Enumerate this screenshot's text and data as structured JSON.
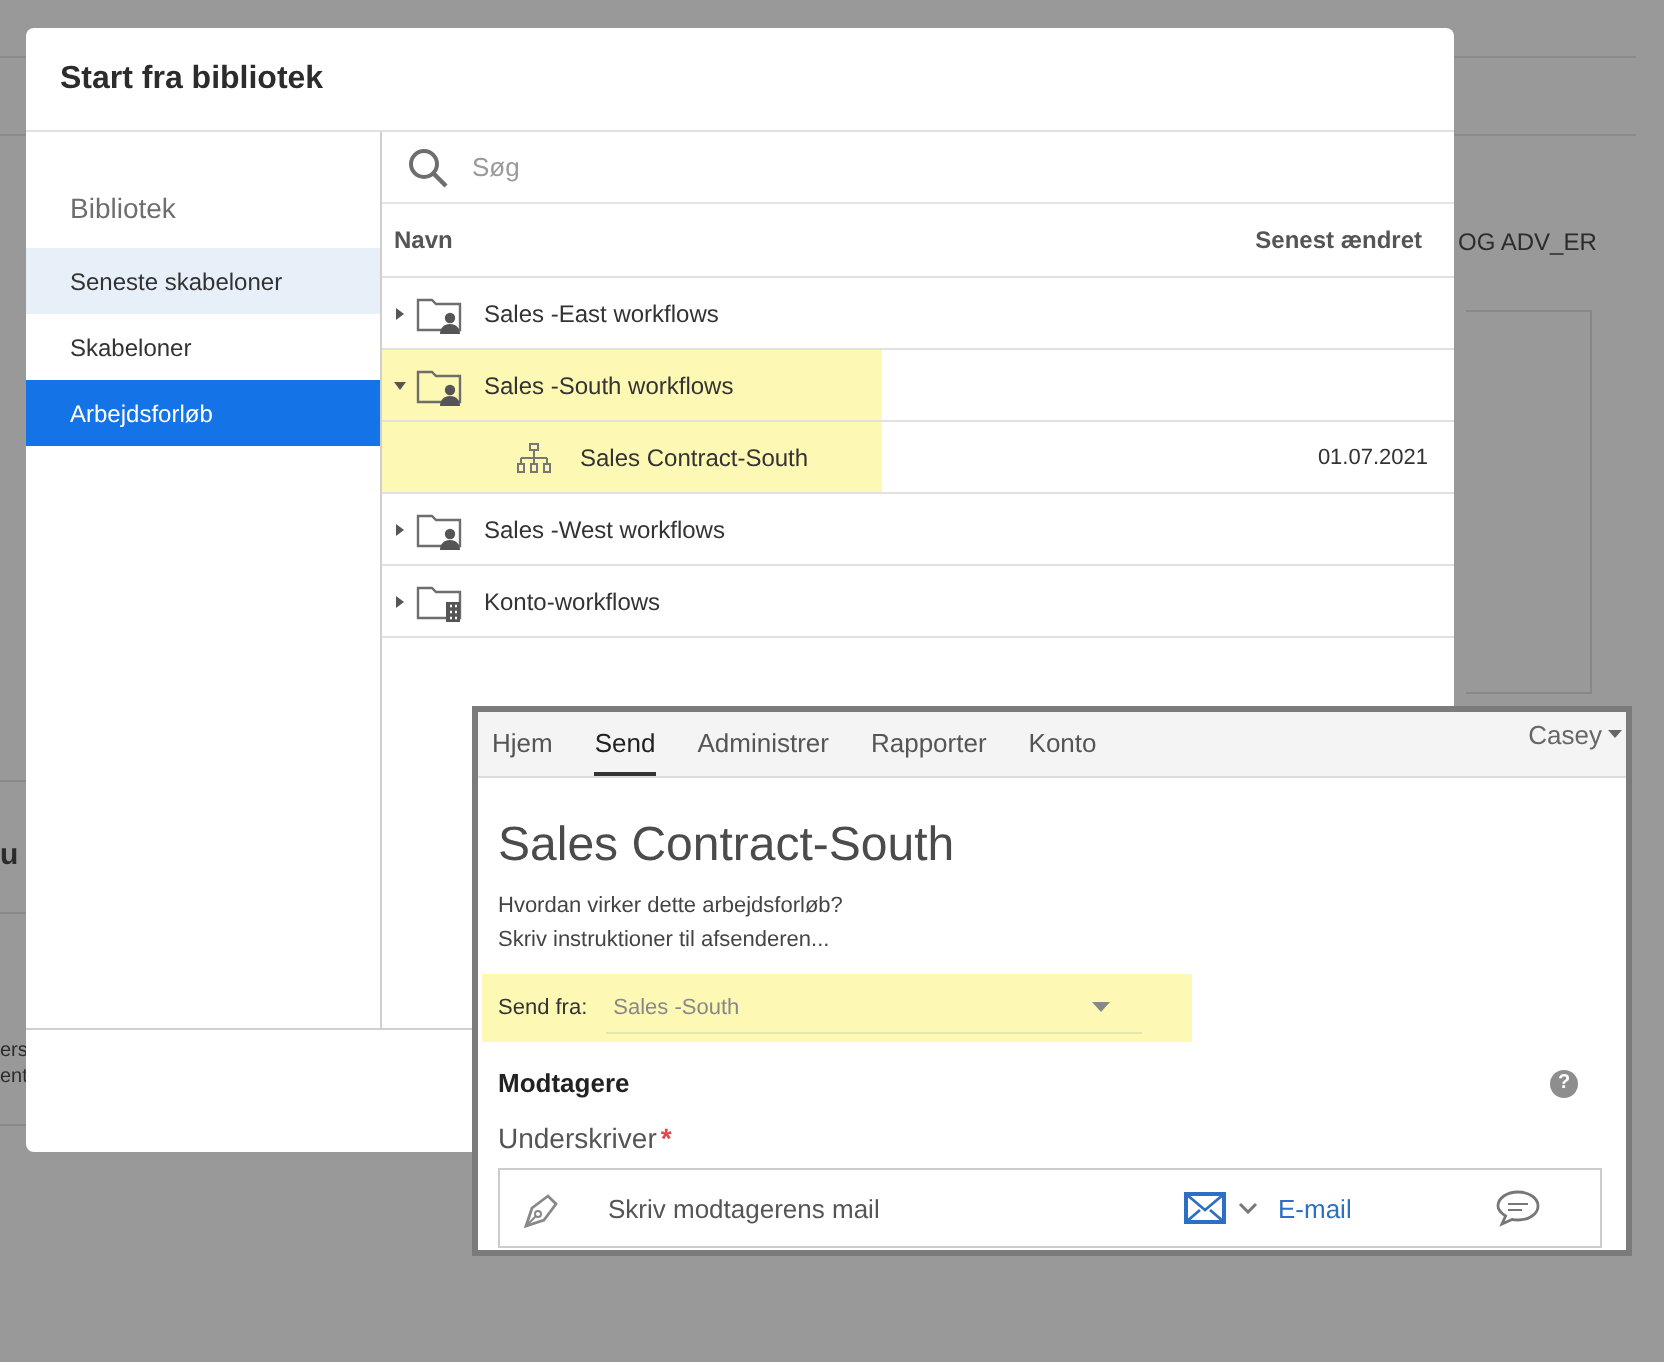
{
  "background_page": {
    "fragments": [
      {
        "text": "OG ADV_ER",
        "kind": "nav"
      },
      {
        "text": "u",
        "kind": "heading"
      },
      {
        "text": "ers",
        "kind": "line1"
      },
      {
        "text": "ent",
        "kind": "line2"
      }
    ]
  },
  "dialog": {
    "title": "Start fra bibliotek",
    "sidebar": {
      "heading": "Bibliotek",
      "items": [
        {
          "label": "Seneste skabeloner",
          "selected": false,
          "hovered": true
        },
        {
          "label": "Skabeloner",
          "selected": false,
          "hovered": false
        },
        {
          "label": "Arbejdsforløb",
          "selected": true,
          "hovered": false
        }
      ]
    },
    "search": {
      "placeholder": "Søg"
    },
    "table": {
      "columns": [
        "Navn",
        "Senest ændret"
      ],
      "rows": [
        {
          "name": "Sales -East workflows",
          "kind": "group-folder",
          "expanded": false,
          "highlighted": false
        },
        {
          "name": "Sales -South workflows",
          "kind": "group-folder",
          "expanded": true,
          "highlighted": true,
          "children": [
            {
              "name": "Sales Contract-South",
              "kind": "workflow",
              "modified": "01.07.2021",
              "highlighted": true
            }
          ]
        },
        {
          "name": "Sales -West workflows",
          "kind": "group-folder",
          "expanded": false,
          "highlighted": false
        },
        {
          "name": "Konto-workflows",
          "kind": "account-folder",
          "expanded": false,
          "highlighted": false
        }
      ]
    }
  },
  "send_panel": {
    "tabs": [
      {
        "label": "Hjem",
        "selected": false
      },
      {
        "label": "Send",
        "selected": true
      },
      {
        "label": "Administrer",
        "selected": false
      },
      {
        "label": "Rapporter",
        "selected": false
      },
      {
        "label": "Konto",
        "selected": false
      }
    ],
    "user": "Casey",
    "title": "Sales Contract-South",
    "description": "Hvordan virker dette arbejdsforløb?",
    "instructions": "Skriv instruktioner til afsenderen...",
    "send_from": {
      "label": "Send fra:",
      "value": "Sales -South",
      "highlighted": true
    },
    "recipients": {
      "heading": "Modtagere",
      "help": "?",
      "role": "Underskriver",
      "required_mark": "*",
      "recipient": {
        "placeholder": "Skriv modtagerens mail",
        "method": "E-mail"
      }
    }
  }
}
